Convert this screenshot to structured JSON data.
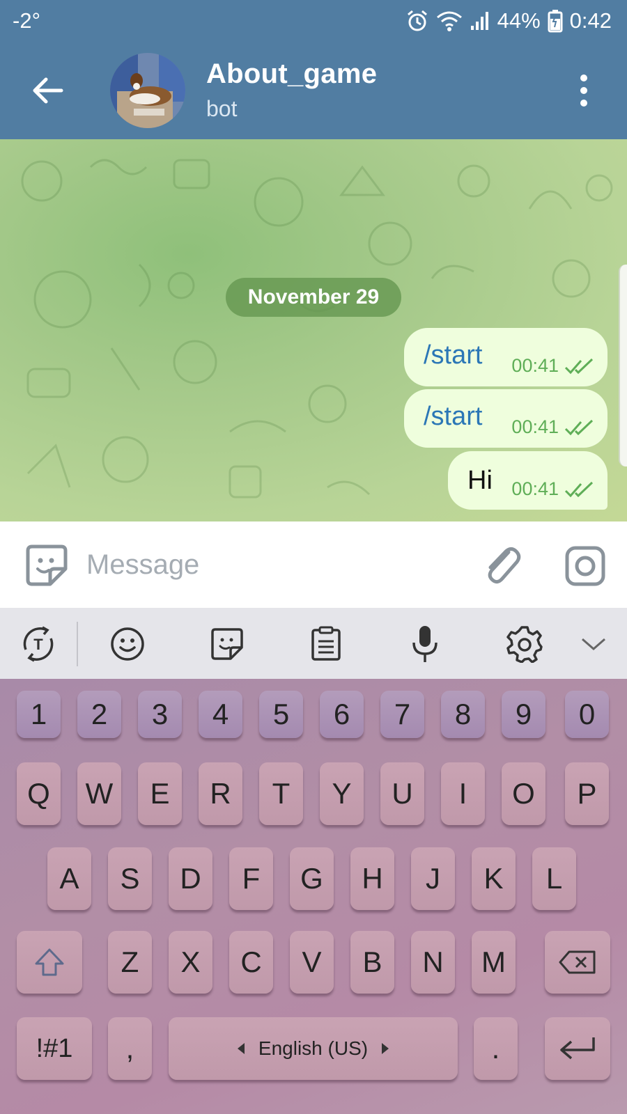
{
  "status_bar": {
    "temperature": "-2°",
    "battery": "44%",
    "time": "0:42",
    "icons": [
      "alarm-icon",
      "wifi-icon",
      "signal-icon",
      "battery-charging-icon"
    ]
  },
  "header": {
    "title": "About_game",
    "subtitle": "bot",
    "icons": [
      "back-arrow-icon",
      "more-vertical-icon"
    ]
  },
  "chat": {
    "date_separator": "November 29",
    "messages": [
      {
        "text": "/start",
        "time": "00:41",
        "status": "read",
        "type": "command"
      },
      {
        "text": "/start",
        "time": "00:41",
        "status": "read",
        "type": "command"
      },
      {
        "text": "Hi",
        "time": "00:41",
        "status": "read",
        "type": "plain"
      }
    ]
  },
  "input_bar": {
    "placeholder": "Message",
    "value": "",
    "icons": [
      "sticker-icon",
      "paperclip-icon",
      "camera-icon"
    ]
  },
  "keyboard_toolbar": {
    "icons": [
      "translate-text-icon",
      "emoji-icon",
      "sticker-icon",
      "clipboard-icon",
      "microphone-icon",
      "settings-gear-icon",
      "collapse-chevron-icon"
    ]
  },
  "keyboard": {
    "row_numbers": [
      "1",
      "2",
      "3",
      "4",
      "5",
      "6",
      "7",
      "8",
      "9",
      "0"
    ],
    "row_q": [
      "Q",
      "W",
      "E",
      "R",
      "T",
      "Y",
      "U",
      "I",
      "O",
      "P"
    ],
    "row_a": [
      "A",
      "S",
      "D",
      "F",
      "G",
      "H",
      "J",
      "K",
      "L"
    ],
    "row_z": [
      "Z",
      "X",
      "C",
      "V",
      "B",
      "N",
      "M"
    ],
    "symbols_label": "!#1",
    "comma": ",",
    "space_label": "English (US)",
    "period": "."
  },
  "colors": {
    "header_bg": "#517da2",
    "bubble_bg": "#effedd",
    "command_text": "#2b77b6",
    "time_text": "#5fae57"
  }
}
